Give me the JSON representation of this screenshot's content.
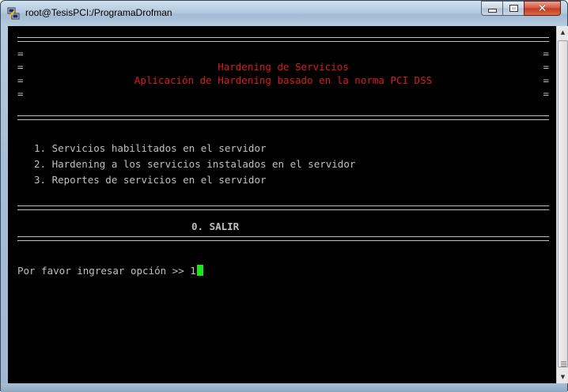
{
  "window": {
    "title": "root@TesisPCI:/ProgramaDrofman",
    "title_icon": "putty-icon",
    "buttons": {
      "minimize": "minimize-icon",
      "maximize": "maximize-icon",
      "close": "close-icon"
    }
  },
  "terminal": {
    "header_title": "Hardening de Servicios",
    "header_subtitle": "Aplicación de Hardening basado en la norma PCI DSS",
    "side_char": "=",
    "menu_items": [
      "1. Servicios habilitados en el servidor",
      "2. Hardening a los servicios instalados en el servidor",
      "3. Reportes de servicios en el servidor"
    ],
    "exit_option": "0. SALIR",
    "prompt": "Por favor ingresar opción >> ",
    "input_value": "1",
    "colors": {
      "background": "#000000",
      "text": "#c0c0c0",
      "header": "#d81d1d",
      "cursor": "#19e619"
    }
  }
}
